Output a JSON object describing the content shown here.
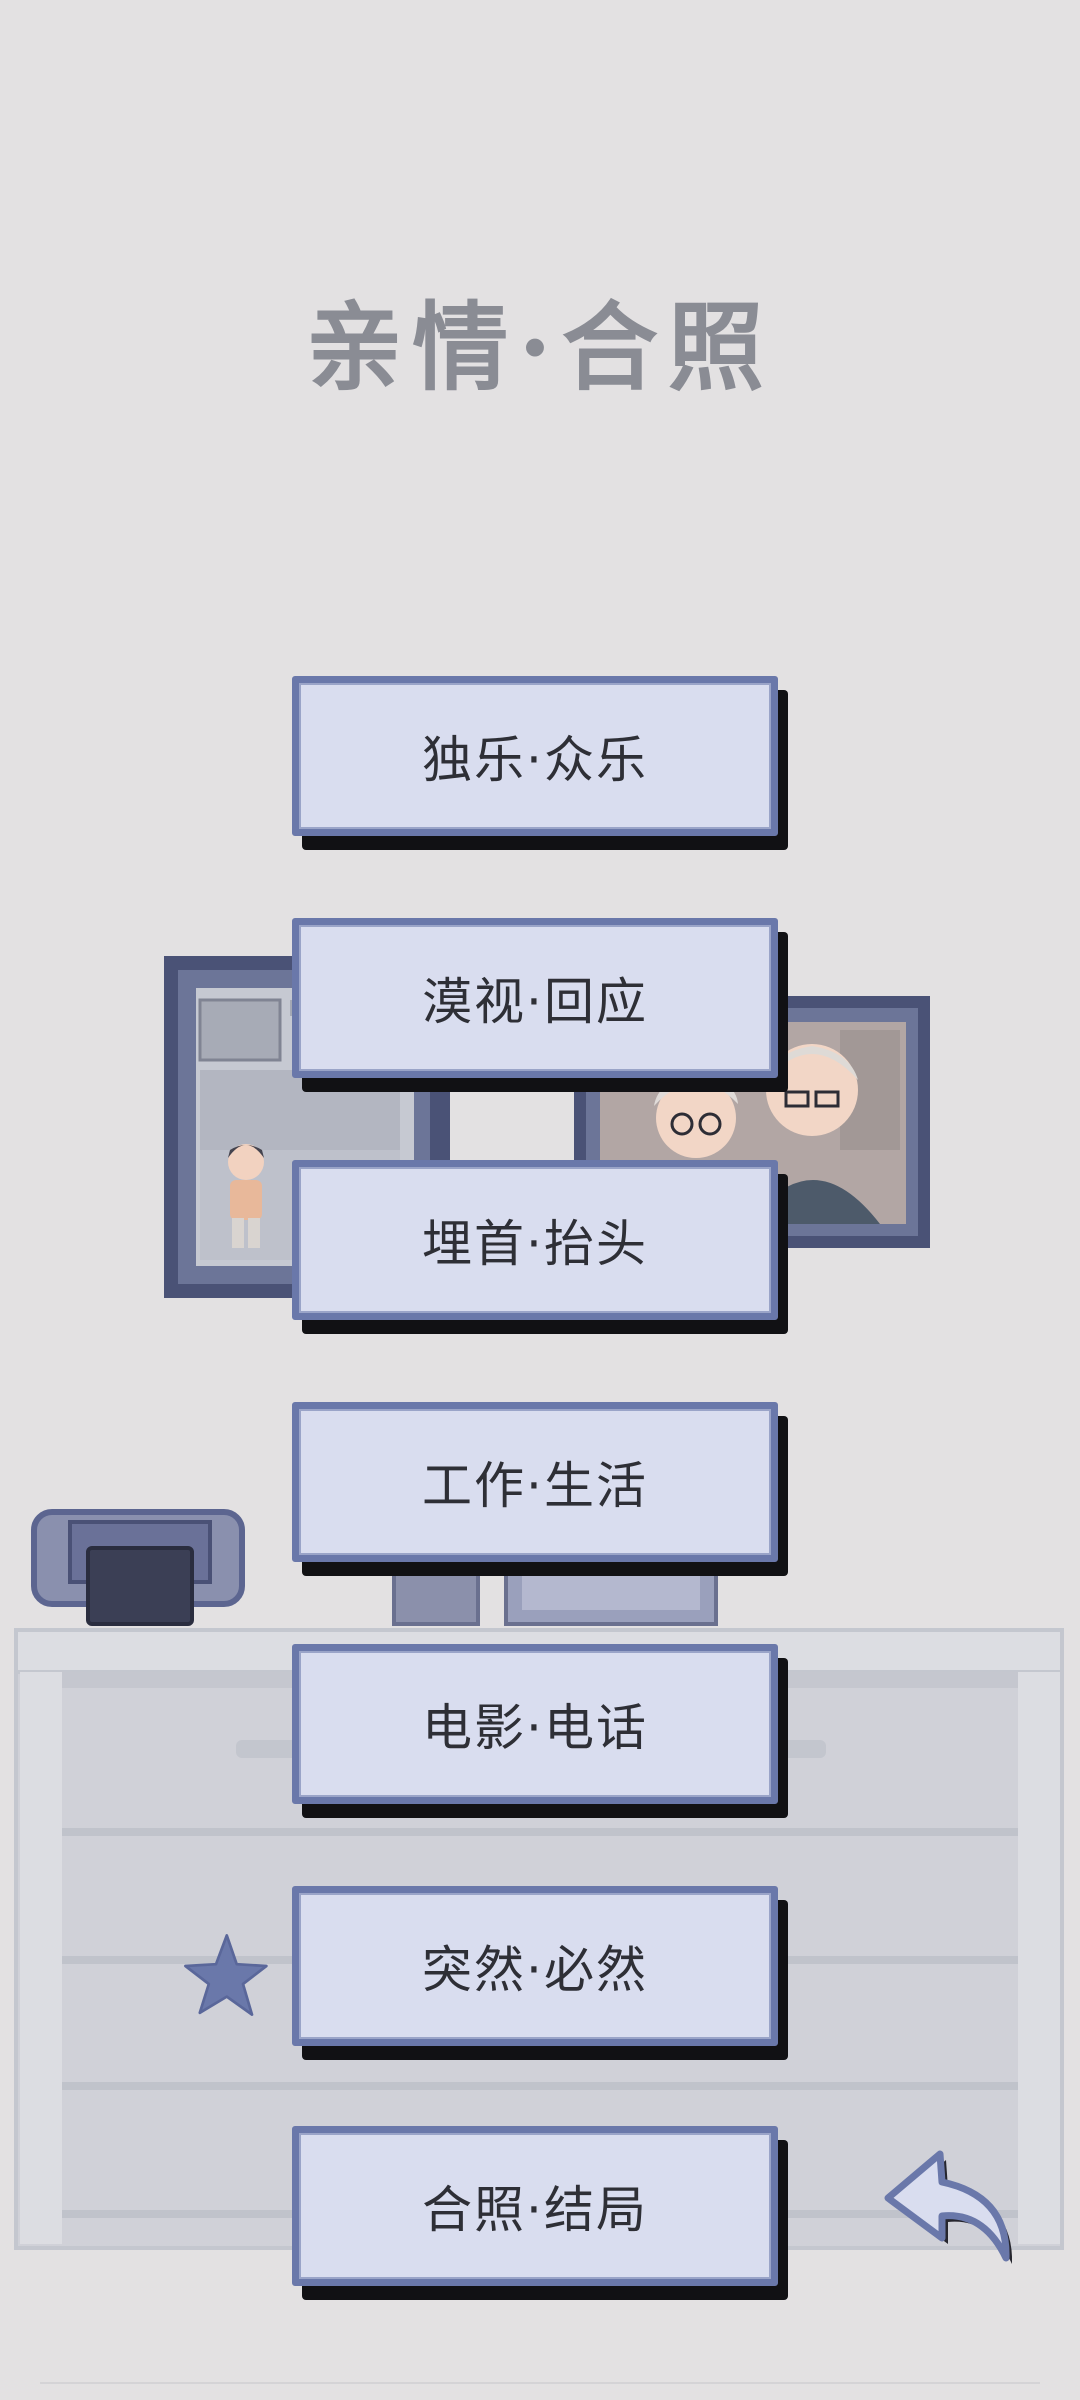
{
  "title": "亲情·合照",
  "menu": [
    {
      "label": "独乐·众乐"
    },
    {
      "label": "漠视·回应"
    },
    {
      "label": "埋首·抬头"
    },
    {
      "label": "工作·生活"
    },
    {
      "label": "电影·电话"
    },
    {
      "label": "突然·必然"
    },
    {
      "label": "合照·结局"
    }
  ],
  "starred_item": "突然·必然",
  "back_icon": "curved-back-arrow-icon",
  "star_icon": "star-icon",
  "colors": {
    "background": "#e3e1e2",
    "button_fill": "#d9ddef",
    "button_border": "#6a78aa",
    "button_shadow": "#111114",
    "title": "#8a8c94",
    "accent_blue": "#6a78aa"
  }
}
